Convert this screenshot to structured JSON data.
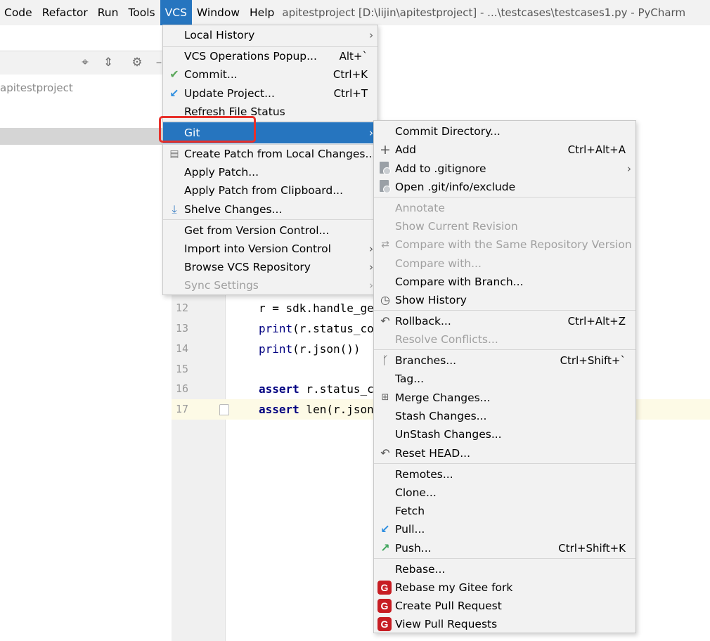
{
  "menubar": {
    "items": [
      "Code",
      "Refactor",
      "Run",
      "Tools",
      "VCS",
      "Window",
      "Help"
    ],
    "window_title": "apitestproject [D:\\lijin\\apitestproject] - ...\\testcases\\testcases1.py - PyCharm"
  },
  "project": {
    "name": "apitestproject"
  },
  "editor": {
    "lines": [
      {
        "num": "12",
        "code": "r = sdk.handle_ge"
      },
      {
        "num": "13",
        "code": "print(r.status_co"
      },
      {
        "num": "14",
        "code": "print(r.json())"
      },
      {
        "num": "15",
        "code": ""
      },
      {
        "num": "16",
        "code": "assert r.status_c"
      },
      {
        "num": "17",
        "code": "assert len(r.json"
      }
    ]
  },
  "vcs_menu": {
    "items": [
      {
        "label": "Local History",
        "arrow": "›"
      },
      {
        "label": "VCS Operations Popup...",
        "shortcut": "Alt+`"
      },
      {
        "label": "Commit...",
        "shortcut": "Ctrl+K",
        "icon": "✔"
      },
      {
        "label": "Update Project...",
        "shortcut": "Ctrl+T",
        "icon": "↙"
      },
      {
        "label": "Refresh File Status"
      },
      {
        "label": "Git",
        "arrow": "›"
      },
      {
        "label": "Create Patch from Local Changes..."
      },
      {
        "label": "Apply Patch..."
      },
      {
        "label": "Apply Patch from Clipboard..."
      },
      {
        "label": "Shelve Changes..."
      },
      {
        "label": "Get from Version Control..."
      },
      {
        "label": "Import into Version Control",
        "arrow": "›"
      },
      {
        "label": "Browse VCS Repository",
        "arrow": "›"
      },
      {
        "label": "Sync Settings",
        "arrow": "›"
      }
    ]
  },
  "git_menu": {
    "items": [
      {
        "label": "Commit Directory..."
      },
      {
        "label": "Add",
        "shortcut": "Ctrl+Alt+A",
        "icon": "+"
      },
      {
        "label": "Add to .gitignore",
        "arrow": "›"
      },
      {
        "label": "Open .git/info/exclude"
      },
      {
        "label": "Annotate"
      },
      {
        "label": "Show Current Revision"
      },
      {
        "label": "Compare with the Same Repository Version"
      },
      {
        "label": "Compare with..."
      },
      {
        "label": "Compare with Branch..."
      },
      {
        "label": "Show History"
      },
      {
        "label": "Rollback...",
        "shortcut": "Ctrl+Alt+Z"
      },
      {
        "label": "Resolve Conflicts..."
      },
      {
        "label": "Branches...",
        "shortcut": "Ctrl+Shift+`"
      },
      {
        "label": "Tag..."
      },
      {
        "label": "Merge Changes..."
      },
      {
        "label": "Stash Changes..."
      },
      {
        "label": "UnStash Changes..."
      },
      {
        "label": "Reset HEAD..."
      },
      {
        "label": "Remotes..."
      },
      {
        "label": "Clone..."
      },
      {
        "label": "Fetch"
      },
      {
        "label": "Pull..."
      },
      {
        "label": "Push...",
        "shortcut": "Ctrl+Shift+K"
      },
      {
        "label": "Rebase..."
      },
      {
        "label": "Rebase my Gitee fork",
        "icon": "G"
      },
      {
        "label": "Create Pull Request",
        "icon": "G"
      },
      {
        "label": "View Pull Requests",
        "icon": "G"
      }
    ]
  },
  "colors": {
    "selection": "#2675bf",
    "highlight_box": "#e8302a",
    "gitee": "#c71d23"
  }
}
